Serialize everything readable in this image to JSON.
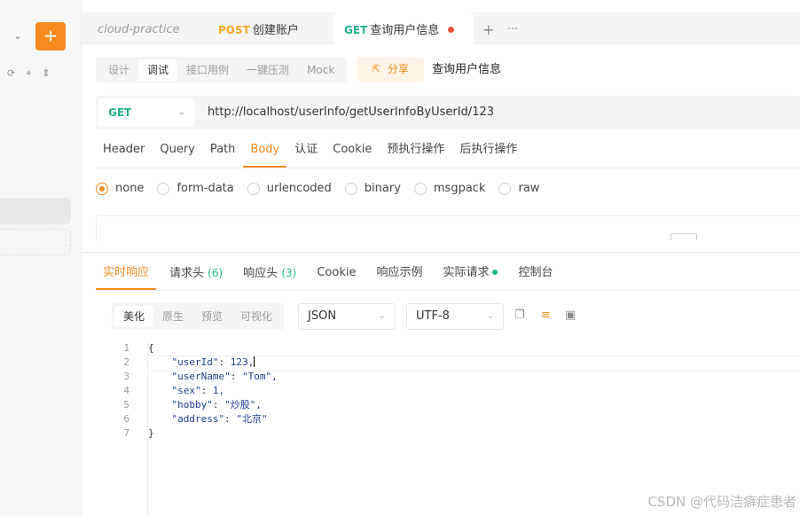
{
  "sidebar": {
    "add_label": "+",
    "dropdown_glyph": "⌄",
    "icons": [
      "refresh-icon",
      "target-icon",
      "sort-icon"
    ]
  },
  "tabs": {
    "project": "cloud-practice",
    "post_method": "POST",
    "post_name": "创建账户",
    "get_method": "GET",
    "get_name": "查询用户信息",
    "add": "+",
    "more": "···"
  },
  "modes": [
    "设计",
    "调试",
    "接口用例",
    "一键压测",
    "Mock"
  ],
  "share_label": "分享",
  "request_name": "查询用户信息",
  "url": {
    "method": "GET",
    "value": "http://localhost/userInfo/getUserInfoByUserId/123"
  },
  "request_tabs": [
    "Header",
    "Query",
    "Path",
    "Body",
    "认证",
    "Cookie",
    "预执行操作",
    "后执行操作"
  ],
  "body_types": [
    "none",
    "form-data",
    "urlencoded",
    "binary",
    "msgpack",
    "raw"
  ],
  "response_tabs": {
    "realtime": "实时响应",
    "req_headers": "请求头",
    "req_headers_count": "(6)",
    "resp_headers": "响应头",
    "resp_headers_count": "(3)",
    "cookie": "Cookie",
    "example": "响应示例",
    "actual": "实际请求",
    "console": "控制台"
  },
  "view_modes": [
    "美化",
    "原生",
    "预览",
    "可视化"
  ],
  "format": "JSON",
  "encoding": "UTF-8",
  "code_lines": [
    {
      "n": "1",
      "text": "{"
    },
    {
      "n": "2",
      "key": "\"userId\"",
      "val": "123,"
    },
    {
      "n": "3",
      "key": "\"userName\"",
      "val": "\"Tom\","
    },
    {
      "n": "4",
      "key": "\"sex\"",
      "val": "1,"
    },
    {
      "n": "5",
      "key": "\"hobby\"",
      "val": "\"炒股\","
    },
    {
      "n": "6",
      "key": "\"address\"",
      "val": "\"北京\""
    },
    {
      "n": "7",
      "text": "}"
    }
  ],
  "watermark": "CSDN @代码洁癖症患者",
  "colors": {
    "accent": "#f58a1f",
    "get": "#1fb58a",
    "post": "#f5a623"
  }
}
